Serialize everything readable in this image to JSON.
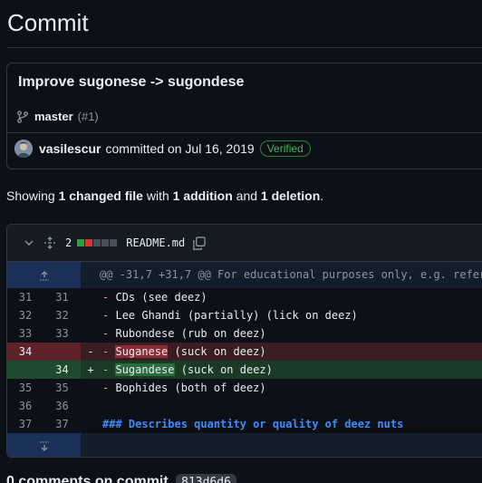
{
  "page": {
    "title": "Commit"
  },
  "commit": {
    "message": "Improve sugonese -> sugondese",
    "branch": "master",
    "pr_ref": "(#1)",
    "author": "vasilescur",
    "action_text": "committed on Jul 16, 2019",
    "verified_label": "Verified"
  },
  "summary": {
    "prefix": "Showing ",
    "changed": "1 changed file",
    "mid1": " with ",
    "additions": "1 addition",
    "mid2": " and ",
    "deletions": "1 deletion",
    "suffix": "."
  },
  "file": {
    "change_count": "2",
    "name": "README.md",
    "diffstat_colors": [
      "#2ea043",
      "#da3633",
      "#484f58",
      "#484f58",
      "#484f58"
    ],
    "hunk_header": "@@ -31,7 +31,7 @@ For educational purposes only, e.g. refer",
    "lines": [
      {
        "type": "context",
        "old": "31",
        "new": "31",
        "marker": "",
        "dash": "-",
        "text": " CDs (see deez)"
      },
      {
        "type": "context",
        "old": "32",
        "new": "32",
        "marker": "",
        "dash": "-",
        "text": " Lee Ghandi (partially) (lick on deez)"
      },
      {
        "type": "context",
        "old": "33",
        "new": "33",
        "marker": "",
        "dash": "-",
        "text": " Rubondese (rub on deez)"
      },
      {
        "type": "del",
        "old": "34",
        "new": "",
        "marker": "-",
        "dash": "-",
        "hl": "Suganese",
        "text": " (suck on deez)"
      },
      {
        "type": "add",
        "old": "",
        "new": "34",
        "marker": "+",
        "dash": "-",
        "hl": "Sugandese",
        "text": " (suck on deez)"
      },
      {
        "type": "context",
        "old": "35",
        "new": "35",
        "marker": "",
        "dash": "-",
        "text": " Bophides (both of deez)"
      },
      {
        "type": "context",
        "old": "36",
        "new": "36",
        "marker": "",
        "dash": "",
        "text": ""
      },
      {
        "type": "heading",
        "old": "37",
        "new": "37",
        "marker": "",
        "dash": "",
        "text": "### Describes quantity or quality of deez nuts"
      }
    ]
  },
  "comments": {
    "label": "0 comments on commit",
    "sha": "813d6d6"
  },
  "icons": {
    "branch": "git-branch-icon",
    "collapse": "chevron-down-icon",
    "expand_all": "unfold-icon",
    "copy": "copy-icon",
    "expand_up": "expand-up-icon",
    "expand_down": "expand-down-icon"
  }
}
